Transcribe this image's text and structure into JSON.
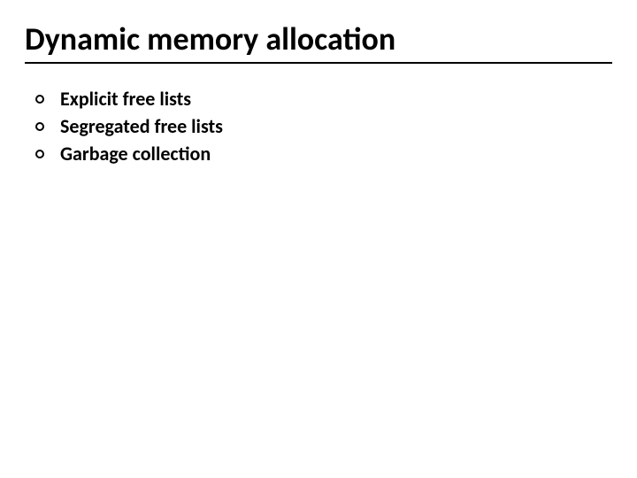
{
  "title": "Dynamic memory allocation",
  "bullets": {
    "item0": "Explicit free lists",
    "item1": "Segregated free lists",
    "item2": "Garbage collection"
  }
}
